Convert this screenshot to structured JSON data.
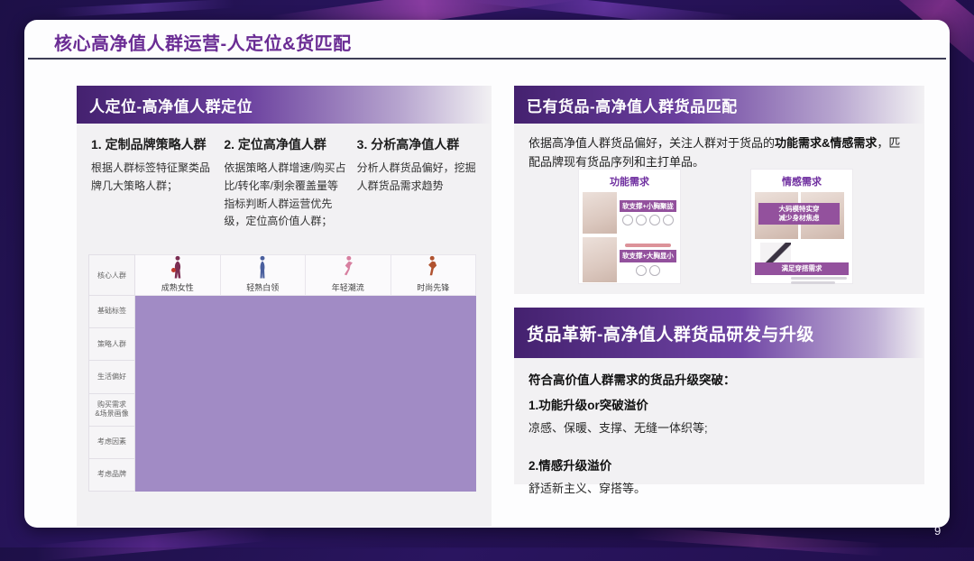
{
  "title": "核心高净值人群运营-人定位&货匹配",
  "page_number": "9",
  "colors": {
    "accent_purple": "#6a2c94",
    "header_gradient_start": "#44216f",
    "panel_gray": "#f2f1f3",
    "table_redact_purple": "#a18bc5",
    "banner_purple": "#93519d",
    "slide_bg_dark": "#22104f"
  },
  "left_panel": {
    "header": "人定位-高净值人群定位",
    "steps": [
      {
        "heading": "1. 定制品牌策略人群",
        "body": "根据人群标签特征聚类品牌几大策略人群；"
      },
      {
        "heading": "2. 定位高净值人群",
        "body": "依据策略人群增速/购买占比/转化率/剩余覆盖量等指标判断人群运营优先级，定位高价值人群；"
      },
      {
        "heading": "3. 分析高净值人群",
        "body": "分析人群货品偏好，挖掘人群货品需求趋势"
      }
    ],
    "table": {
      "corner_label": "核心人群",
      "columns": [
        "成熟女性",
        "轻熟白领",
        "年轻潮流",
        "时尚先锋"
      ],
      "row_labels": [
        "基础标签",
        "策略人群",
        "生活偏好",
        "购买需求\n&场景画像",
        "考虑因素",
        "考虑品牌"
      ]
    }
  },
  "right_top": {
    "header": "已有货品-高净值人群货品匹配",
    "intro_prefix": "依据高净值人群货品偏好，关注人群对于货品的",
    "intro_bold": "功能需求&情感需求",
    "intro_suffix": "，匹配品牌现有货品序列和主打单品。",
    "cards": [
      {
        "title": "功能需求",
        "banners": [
          "软支撑+小胸聚拢",
          "软支撑+大胸显小"
        ]
      },
      {
        "title": "情感需求",
        "banners": [
          "大码模特实穿\n减少身材焦虑",
          "满足穿搭需求"
        ]
      }
    ]
  },
  "right_bottom": {
    "header": "货品革新-高净值人群货品研发与升级",
    "intro": "符合高价值人群需求的货品升级突破：",
    "items": [
      {
        "heading": "1.功能升级or突破溢价",
        "body": "凉感、保暖、支撑、无缝一体织等;"
      },
      {
        "heading": "2.情感升级溢价",
        "body": "舒适新主义、穿搭等。"
      }
    ]
  }
}
